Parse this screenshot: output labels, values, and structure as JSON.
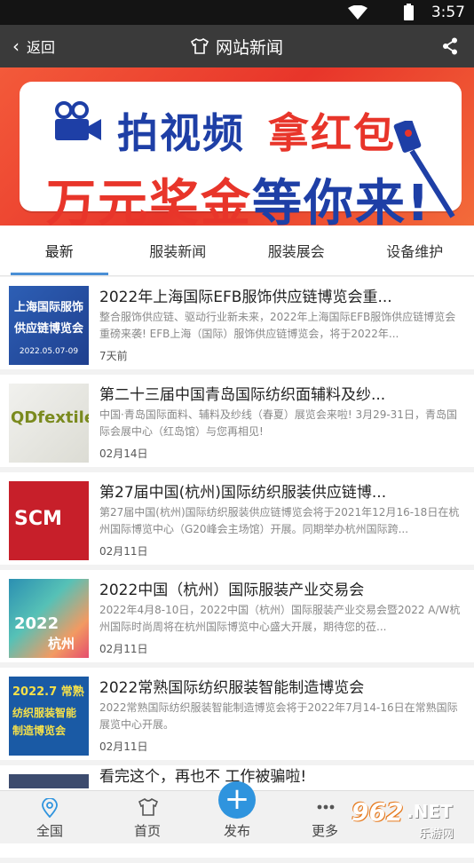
{
  "status_bar": {
    "time": "3:57"
  },
  "header": {
    "back_label": "返回",
    "title": "网站新闻"
  },
  "banner": {
    "line1_a": "拍视频",
    "line1_b": "拿红包",
    "line2_a": "万元奖金",
    "line2_b": "等你来!",
    "thumb_text_a": "¥"
  },
  "tabs": [
    {
      "label": "最新",
      "active": true
    },
    {
      "label": "服装新闻"
    },
    {
      "label": "服装展会"
    },
    {
      "label": "设备维护"
    }
  ],
  "news": [
    {
      "title": "2022年上海国际EFB服饰供应链博览会重...",
      "desc": "整合服饰供应链、驱动行业新未来，2022年上海国际EFB服饰供应链博览会重磅来袭! EFB上海（国际）服饰供应链博览会，将于2022年...",
      "date": "7天前",
      "thumb_lines": [
        "上海国际服饰",
        "供应链博览会",
        "2022.05.07-09"
      ]
    },
    {
      "title": "第二十三届中国青岛国际纺织面辅料及纱...",
      "desc": "中国·青岛国际面料、辅料及纱线（春夏）展览会来啦! 3月29-31日，青岛国际会展中心（红岛馆）与您再相见!",
      "date": "02月14日",
      "thumb_text": "QDfextile"
    },
    {
      "title": "第27届中国(杭州)国际纺织服装供应链博...",
      "desc": "第27届中国(杭州)国际纺织服装供应链博览会将于2021年12月16-18日在杭州国际博览中心（G20峰会主场馆）开展。同期举办杭州国际跨...",
      "date": "02月11日",
      "thumb_text": "SCM"
    },
    {
      "title": "2022中国（杭州）国际服装产业交易会",
      "desc": "2022年4月8-10日，2022中国（杭州）国际服装产业交易会暨2022 A/W杭州国际时尚周将在杭州国际博览中心盛大开展，期待您的莅...",
      "date": "02月11日",
      "thumb_lines": [
        "2022",
        "杭州"
      ]
    },
    {
      "title": "2022常熟国际纺织服装智能制造博览会",
      "desc": "2022常熟国际纺织服装智能制造博览会将于2022年7月14-16日在常熟国际展览中心开展。",
      "date": "02月11日",
      "thumb_lines": [
        "2022.7 常熟",
        "纺织服装智能",
        "制造博览会"
      ]
    },
    {
      "title": "看完这个，再也不          工作被骗啦!"
    }
  ],
  "bottom_nav": [
    {
      "label": "全国",
      "icon": "location-icon"
    },
    {
      "label": "首页",
      "icon": "shirt-icon"
    },
    {
      "label": "发布",
      "icon": "plus-icon"
    },
    {
      "label": "更多",
      "icon": "more-icon"
    }
  ],
  "watermark": {
    "number": "962",
    "suffix": ".NET",
    "site": "乐游网"
  },
  "colors": {
    "accent": "#4a8fd6",
    "fab": "#2f94de",
    "appbar": "#3a3a3a",
    "banner_red": "#e8352a",
    "banner_blue": "#1e3fa6"
  }
}
